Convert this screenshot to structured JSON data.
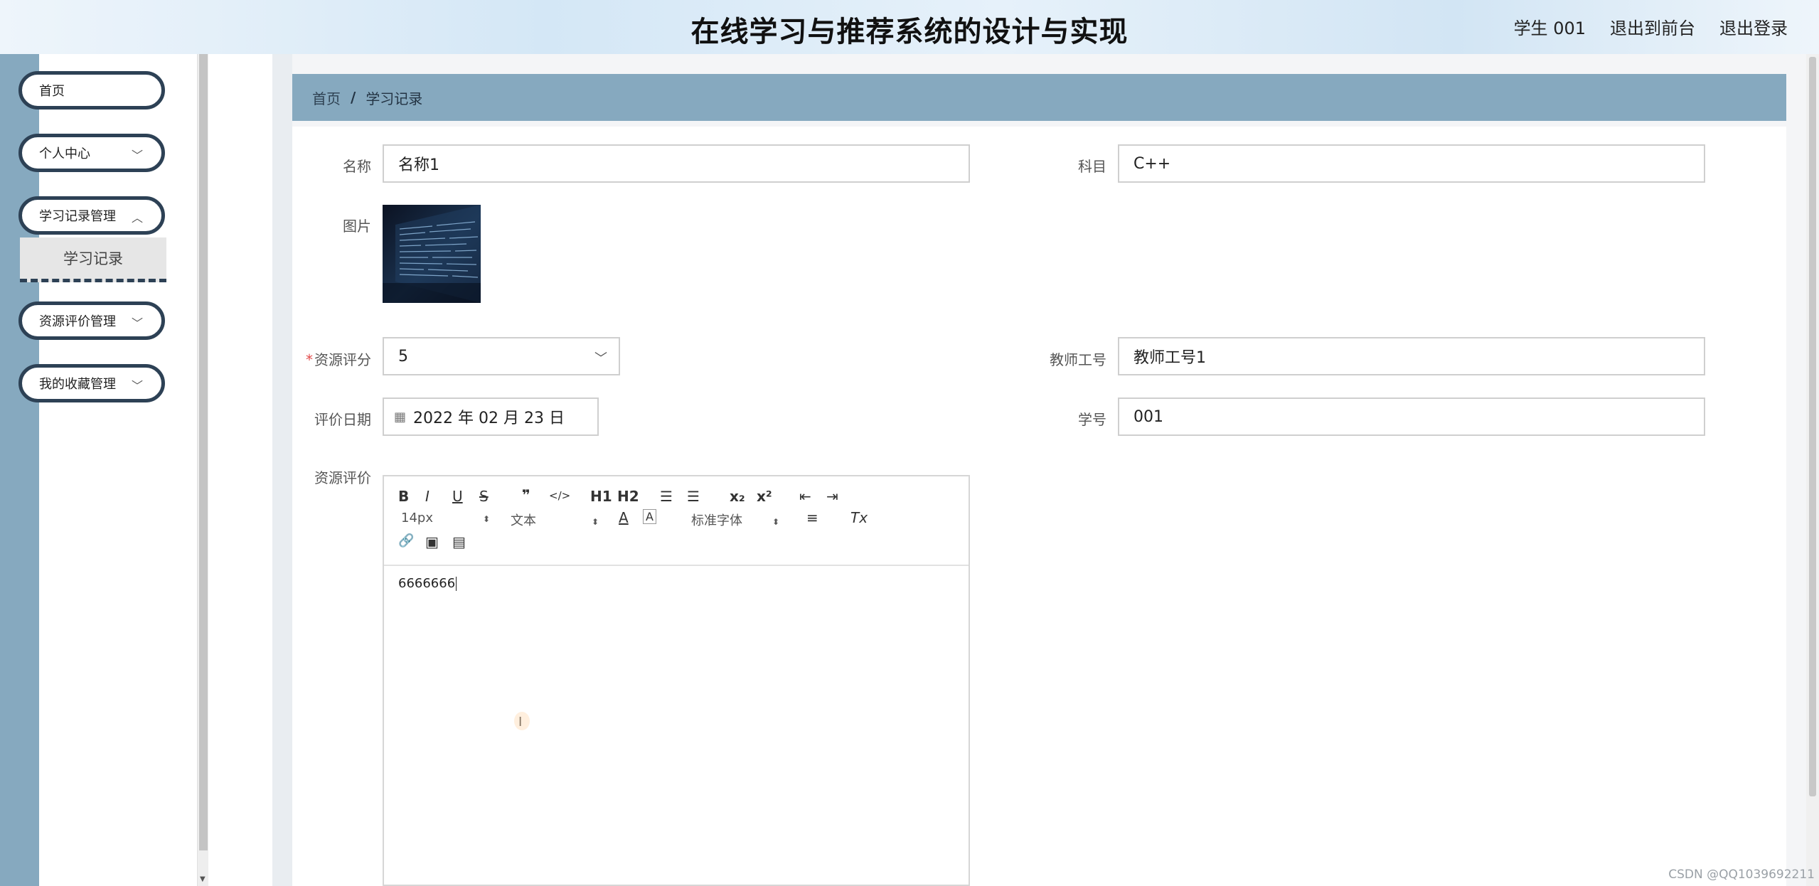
{
  "header": {
    "title": "在线学习与推荐系统的设计与实现",
    "links": [
      "学生 001",
      "退出到前台",
      "退出登录"
    ]
  },
  "sidebar": {
    "items": [
      {
        "label": "首页",
        "has_chevron": false
      },
      {
        "label": "个人中心",
        "has_chevron": true
      },
      {
        "label": "学习记录管理",
        "has_chevron": true
      },
      {
        "label": "资源评价管理",
        "has_chevron": true
      },
      {
        "label": "我的收藏管理",
        "has_chevron": true
      }
    ],
    "submenu_active": "学习记录"
  },
  "breadcrumb": {
    "home": "首页",
    "separator": "/",
    "current": "学习记录"
  },
  "form": {
    "name": {
      "label": "名称",
      "value": "名称1"
    },
    "subject": {
      "label": "科目",
      "value": "C++"
    },
    "image": {
      "label": "图片"
    },
    "rating": {
      "label": "资源评分",
      "required_mark": "*",
      "value": "5"
    },
    "teacher_id": {
      "label": "教师工号",
      "value": "教师工号1"
    },
    "eval_date": {
      "label": "评价日期",
      "value": "2022 年 02 月 23 日"
    },
    "student_id": {
      "label": "学号",
      "value": "001"
    },
    "review": {
      "label": "资源评价",
      "content": "6666666"
    }
  },
  "editor_toolbar": {
    "font_size": "14px",
    "text_style": "文本",
    "font_family": "标准字体",
    "buttons": {
      "bold": "B",
      "italic": "I",
      "underline": "U",
      "strike": "S",
      "quote": "❞",
      "code": "</>",
      "h1": "H1",
      "h2": "H2",
      "ordered_list": "☰",
      "bullet_list": "☰",
      "subscript": "x₂",
      "superscript": "x²",
      "outdent": "⇤",
      "indent": "⇥",
      "color": "A",
      "background": "A",
      "align": "≡",
      "clean": "Tx",
      "link": "🔗",
      "image": "▣",
      "video": "▤"
    }
  },
  "watermark": "CSDN @QQ1039692211",
  "colors": {
    "sidebar_accent": "#86a9bf",
    "menu_border": "#2d4155",
    "required": "#e24c4c"
  }
}
